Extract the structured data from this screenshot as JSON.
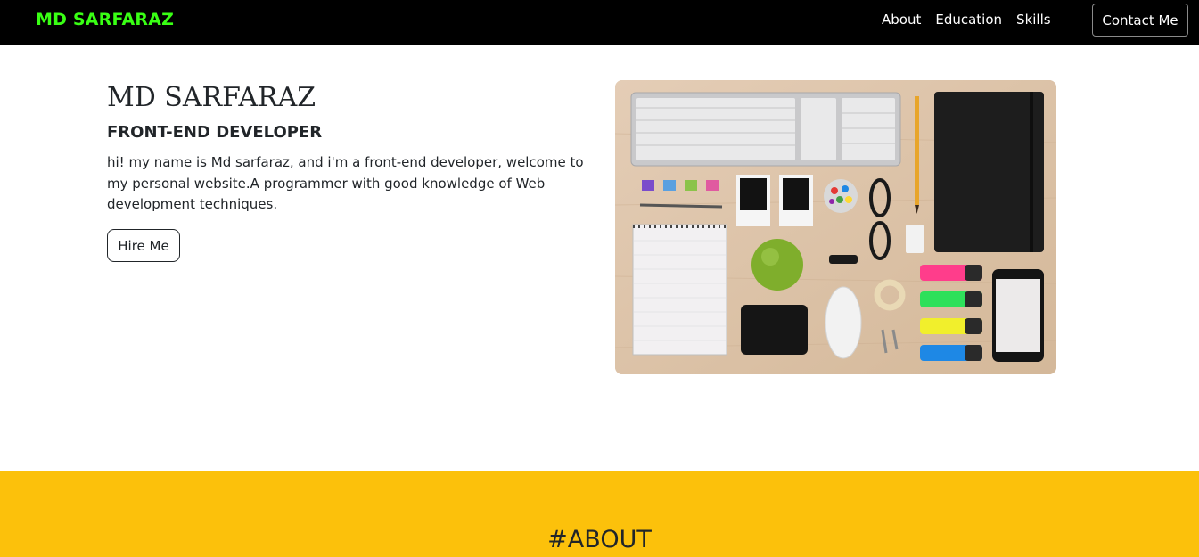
{
  "navbar": {
    "brand": "MD SARFARAZ",
    "links": [
      "About",
      "Education",
      "Skills"
    ],
    "contact_label": "Contact Me"
  },
  "hero": {
    "name": "MD SARFARAZ",
    "role": "FRONT-END DEVELOPER",
    "description": "hi! my name is Md sarfaraz, and i'm a front-end developer, welcome to my personal website.A programmer with good knowledge of Web development techniques.",
    "hire_label": "Hire Me"
  },
  "about": {
    "title": "#ABOUT"
  },
  "colors": {
    "navbar_bg": "#000000",
    "brand": "#39ff14",
    "about_bg": "#fcc10b",
    "text": "#212529"
  }
}
